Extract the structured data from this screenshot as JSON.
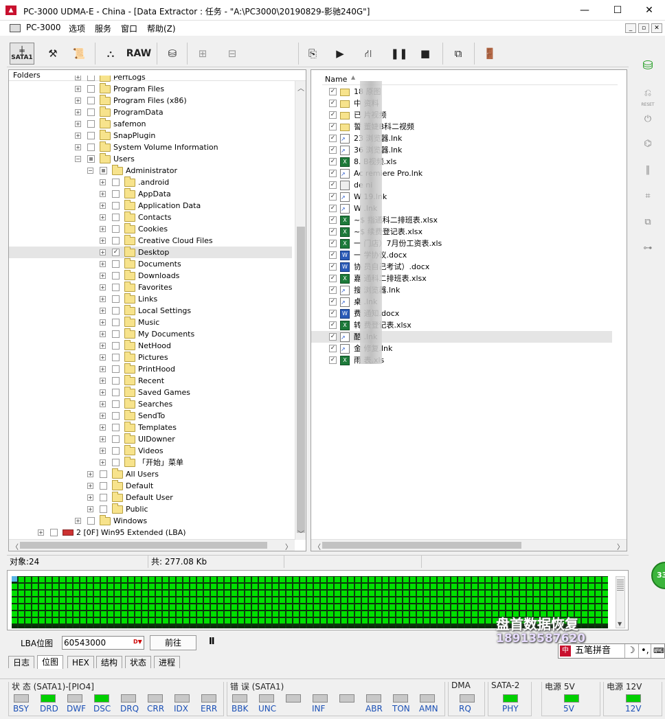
{
  "window": {
    "title": "PC-3000 UDMA-E - China - [Data Extractor : 任务 - \"A:\\PC3000\\20190829-影驰240G\"]",
    "app_icon": "pc3000-logo",
    "controls": {
      "minimize": "—",
      "maximize": "☐",
      "close": "✕"
    }
  },
  "menu": {
    "items": [
      "PC-3000",
      "选项",
      "服务",
      "窗口",
      "帮助(Z)"
    ],
    "mdi_controls": [
      "_",
      "▫",
      "✕"
    ]
  },
  "toolbar": {
    "sata_label": "SATA1",
    "raw_label": "RAW",
    "buttons": [
      "sata1",
      "tools",
      "script",
      "binoculars",
      "raw",
      "disk-save",
      "tree-a",
      "tree-b",
      "export",
      "play",
      "chart",
      "pause",
      "stop",
      "copy",
      "exit"
    ]
  },
  "folders_panel": {
    "header": "Folders",
    "rows": [
      {
        "label": "PerfLogs",
        "level": 1,
        "exp": "+",
        "chk": "none"
      },
      {
        "label": "Program Files",
        "level": 1,
        "exp": "+",
        "chk": "none"
      },
      {
        "label": "Program Files (x86)",
        "level": 1,
        "exp": "+",
        "chk": "none"
      },
      {
        "label": "ProgramData",
        "level": 1,
        "exp": "+",
        "chk": "none"
      },
      {
        "label": "safemon",
        "level": 1,
        "exp": "+",
        "chk": "none"
      },
      {
        "label": "SnapPlugin",
        "level": 1,
        "exp": "+",
        "chk": "none"
      },
      {
        "label": "System Volume Information",
        "level": 1,
        "exp": "+",
        "chk": "none"
      },
      {
        "label": "Users",
        "level": 1,
        "exp": "-",
        "chk": "part"
      },
      {
        "label": "Administrator",
        "level": 2,
        "exp": "-",
        "chk": "part"
      },
      {
        "label": ".android",
        "level": 3,
        "exp": "+",
        "chk": "none"
      },
      {
        "label": "AppData",
        "level": 3,
        "exp": "+",
        "chk": "none"
      },
      {
        "label": "Application Data",
        "level": 3,
        "exp": "+",
        "chk": "none"
      },
      {
        "label": "Contacts",
        "level": 3,
        "exp": "+",
        "chk": "none"
      },
      {
        "label": "Cookies",
        "level": 3,
        "exp": "+",
        "chk": "none"
      },
      {
        "label": "Creative Cloud Files",
        "level": 3,
        "exp": "+",
        "chk": "none"
      },
      {
        "label": "Desktop",
        "level": 3,
        "exp": "+",
        "chk": "check",
        "selected": true
      },
      {
        "label": "Documents",
        "level": 3,
        "exp": "+",
        "chk": "none"
      },
      {
        "label": "Downloads",
        "level": 3,
        "exp": "+",
        "chk": "none"
      },
      {
        "label": "Favorites",
        "level": 3,
        "exp": "+",
        "chk": "none"
      },
      {
        "label": "Links",
        "level": 3,
        "exp": "+",
        "chk": "none"
      },
      {
        "label": "Local Settings",
        "level": 3,
        "exp": "+",
        "chk": "none"
      },
      {
        "label": "Music",
        "level": 3,
        "exp": "+",
        "chk": "none"
      },
      {
        "label": "My Documents",
        "level": 3,
        "exp": "+",
        "chk": "none"
      },
      {
        "label": "NetHood",
        "level": 3,
        "exp": "+",
        "chk": "none"
      },
      {
        "label": "Pictures",
        "level": 3,
        "exp": "+",
        "chk": "none"
      },
      {
        "label": "PrintHood",
        "level": 3,
        "exp": "+",
        "chk": "none"
      },
      {
        "label": "Recent",
        "level": 3,
        "exp": "+",
        "chk": "none"
      },
      {
        "label": "Saved Games",
        "level": 3,
        "exp": "+",
        "chk": "none"
      },
      {
        "label": "Searches",
        "level": 3,
        "exp": "+",
        "chk": "none"
      },
      {
        "label": "SendTo",
        "level": 3,
        "exp": "+",
        "chk": "none"
      },
      {
        "label": "Templates",
        "level": 3,
        "exp": "+",
        "chk": "none"
      },
      {
        "label": "UIDowner",
        "level": 3,
        "exp": "+",
        "chk": "none"
      },
      {
        "label": "Videos",
        "level": 3,
        "exp": "+",
        "chk": "none"
      },
      {
        "label": "「开始」菜单",
        "level": 3,
        "exp": "+",
        "chk": "none"
      },
      {
        "label": "All Users",
        "level": 2,
        "exp": "+",
        "chk": "none"
      },
      {
        "label": "Default",
        "level": 2,
        "exp": "+",
        "chk": "none"
      },
      {
        "label": "Default User",
        "level": 2,
        "exp": "+",
        "chk": "none"
      },
      {
        "label": "Public",
        "level": 2,
        "exp": "+",
        "chk": "none"
      },
      {
        "label": "Windows",
        "level": 1,
        "exp": "+",
        "chk": "none"
      },
      {
        "label": "2 [0F] Win95 Extended  (LBA)",
        "level": 0,
        "exp": "+",
        "chk": "none",
        "partition": true
      }
    ]
  },
  "files_panel": {
    "header": "Name",
    "files": [
      {
        "name": "18      原图",
        "type": "folder"
      },
      {
        "name": "中      资料",
        "type": "folder"
      },
      {
        "name": "已      片视频",
        "type": "folder"
      },
      {
        "name": "誓      董婕B科二视频",
        "type": "folder"
      },
      {
        "name": "23      浏览器.lnk",
        "type": "lnk"
      },
      {
        "name": "36      浏览器.lnk",
        "type": "lnk"
      },
      {
        "name": "8.      B视频.xls",
        "type": "xls"
      },
      {
        "name": "Ac      remiere Pro.lnk",
        "type": "lnk"
      },
      {
        "name": "de      ni",
        "type": "ini"
      },
      {
        "name": "W      19.lnk",
        "type": "lnk"
      },
      {
        "name": "W      .lnk",
        "type": "lnk"
      },
      {
        "name": "~$      指通科二排班表.xlsx",
        "type": "xls"
      },
      {
        "name": "~$      续费登记表.xlsx",
        "type": "xls"
      },
      {
        "name": "一      门店）7月份工资表.xls",
        "type": "xls"
      },
      {
        "name": "一      学协议.docx",
        "type": "doc"
      },
      {
        "name": "协      员自己考试）.docx",
        "type": "doc"
      },
      {
        "name": "嘉      通科二排班表.xlsx",
        "type": "xls"
      },
      {
        "name": "搜      浏览器.lnk",
        "type": "lnk"
      },
      {
        "name": "桌      .lnk",
        "type": "lnk"
      },
      {
        "name": "费      通知.docx",
        "type": "doc"
      },
      {
        "name": "转      费登记表.xlsx",
        "type": "xls"
      },
      {
        "name": "酷      .lnk",
        "type": "lnk",
        "selected": true
      },
      {
        "name": "金      修复.lnk",
        "type": "lnk"
      },
      {
        "name": "雨      表.xls",
        "type": "xls"
      }
    ]
  },
  "status": {
    "objects": "对象:24",
    "total": "共:  277.08 Kb"
  },
  "lba": {
    "label": "LBA位图",
    "value": "60543000",
    "goto_button": "前往",
    "pause_icon": "Ⅱ"
  },
  "tabs": [
    "日志",
    "位图",
    "HEX",
    "结构",
    "状态",
    "进程"
  ],
  "active_tab": "位图",
  "ime": {
    "label": "五笔拼音"
  },
  "watermark": {
    "line1": "盘首数据恢复",
    "line2": "18913587620"
  },
  "bubble": "33",
  "led_groups": [
    {
      "title": "状 态 (SATA1)-[PIO4]",
      "leds": [
        {
          "label": "BSY",
          "on": false
        },
        {
          "label": "DRD",
          "on": true
        },
        {
          "label": "DWF",
          "on": false
        },
        {
          "label": "DSC",
          "on": true
        },
        {
          "label": "DRQ",
          "on": false
        },
        {
          "label": "CRR",
          "on": false
        },
        {
          "label": "IDX",
          "on": false
        },
        {
          "label": "ERR",
          "on": false
        }
      ]
    },
    {
      "title": "错 误 (SATA1)",
      "leds": [
        {
          "label": "BBK",
          "on": false
        },
        {
          "label": "UNC",
          "on": false
        },
        {
          "label": "",
          "on": false
        },
        {
          "label": "INF",
          "on": false
        },
        {
          "label": "",
          "on": false
        },
        {
          "label": "ABR",
          "on": false
        },
        {
          "label": "TON",
          "on": false
        },
        {
          "label": "AMN",
          "on": false
        }
      ]
    },
    {
      "title": "DMA",
      "leds": [
        {
          "label": "RQ",
          "on": false
        }
      ]
    },
    {
      "title": "SATA-2",
      "leds": [
        {
          "label": "PHY",
          "on": true
        }
      ]
    },
    {
      "title": "电源 5V",
      "leds": [
        {
          "label": "5V",
          "on": true
        }
      ]
    },
    {
      "title": "电源 12V",
      "leds": [
        {
          "label": "12V",
          "on": true
        }
      ]
    }
  ],
  "colors": {
    "led_on": "#00d000",
    "led_off": "#c8c8c8",
    "map_block": "#00e000",
    "led_label": "#1a4fb5"
  }
}
